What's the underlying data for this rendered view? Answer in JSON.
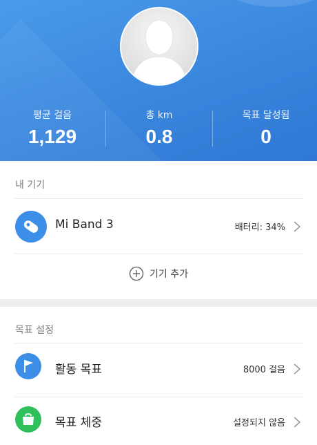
{
  "header": {
    "stats": [
      {
        "label": "평균 걸음",
        "value": "1,129"
      },
      {
        "label": "총 km",
        "value": "0.8"
      },
      {
        "label": "목표 달성됨",
        "value": "0"
      }
    ]
  },
  "devices": {
    "section_title": "내 기기",
    "items": [
      {
        "name": "Mi Band 3",
        "status": "배터리: 34%",
        "icon": "band-icon",
        "icon_color": "#3c8ee6"
      }
    ],
    "add_label": "기기 추가"
  },
  "goals": {
    "section_title": "목표 설정",
    "items": [
      {
        "name": "활동 목표",
        "value": "8000 걸음",
        "icon": "flag-icon",
        "icon_color": "#3c8ee6"
      },
      {
        "name": "목표 체중",
        "value": "설정되지 않음",
        "icon": "weight-icon",
        "icon_color": "#2fbf5b"
      }
    ]
  }
}
